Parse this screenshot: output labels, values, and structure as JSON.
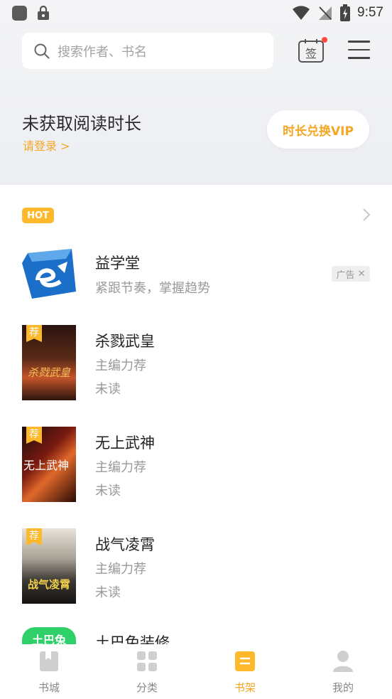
{
  "status_bar": {
    "time": "9:57"
  },
  "search": {
    "placeholder": "搜索作者、书名"
  },
  "sign_in": {
    "label": "签"
  },
  "reading": {
    "title": "未获取阅读时长",
    "login": "请登录 >",
    "vip_button": "时长兑换VIP"
  },
  "hot": {
    "badge": "HOT"
  },
  "books": [
    {
      "title": "益学堂",
      "line1": "紧跟节奏，掌握趋势",
      "line2": "",
      "tag": "",
      "ad": "广告"
    },
    {
      "title": "杀戮武皇",
      "line1": "主编力荐",
      "line2": "未读",
      "tag": "荐",
      "cover_text": "杀戮武皇"
    },
    {
      "title": "无上武神",
      "line1": "主编力荐",
      "line2": "未读",
      "tag": "荐",
      "cover_text": "无上武神"
    },
    {
      "title": "战气凌霄",
      "line1": "主编力荐",
      "line2": "未读",
      "tag": "荐",
      "cover_text": "战气凌霄"
    },
    {
      "title": "土巴兔装修",
      "cover_text": "土巴兔"
    }
  ],
  "tabs": [
    {
      "label": "书城",
      "active": false
    },
    {
      "label": "分类",
      "active": false
    },
    {
      "label": "书架",
      "active": true
    },
    {
      "label": "我的",
      "active": false
    }
  ],
  "colors": {
    "accent": "#f5a623",
    "badge": "#fdb82b",
    "green": "#2fcf6a"
  }
}
